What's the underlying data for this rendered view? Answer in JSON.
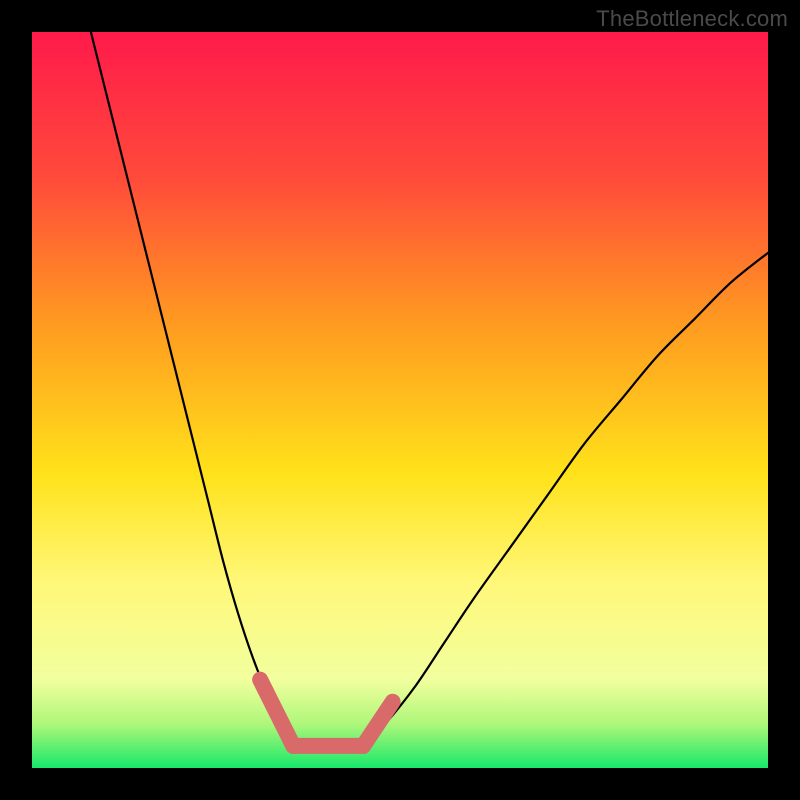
{
  "watermark": "TheBottleneck.com",
  "chart_data": {
    "type": "line",
    "title": "",
    "xlabel": "",
    "ylabel": "",
    "xlim": [
      0,
      100
    ],
    "ylim": [
      0,
      100
    ],
    "gradient_stops": [
      {
        "offset": 0,
        "color": "#ff1a4b"
      },
      {
        "offset": 20,
        "color": "#ff4b3a"
      },
      {
        "offset": 40,
        "color": "#ff9c20"
      },
      {
        "offset": 60,
        "color": "#ffe21a"
      },
      {
        "offset": 75,
        "color": "#fff87a"
      },
      {
        "offset": 88,
        "color": "#f2ff9e"
      },
      {
        "offset": 94,
        "color": "#aef77a"
      },
      {
        "offset": 100,
        "color": "#18e86a"
      }
    ],
    "series": [
      {
        "name": "left-curve",
        "x": [
          8,
          10,
          12,
          14,
          16,
          18,
          20,
          22,
          24,
          26,
          28,
          30,
          32,
          34,
          35.5
        ],
        "y": [
          100,
          92,
          84,
          76,
          68,
          60,
          52,
          44,
          36,
          28,
          21,
          15,
          10,
          6,
          3
        ]
      },
      {
        "name": "right-curve",
        "x": [
          45,
          48,
          52,
          56,
          60,
          65,
          70,
          75,
          80,
          85,
          90,
          95,
          100
        ],
        "y": [
          3,
          6,
          11,
          17,
          23,
          30,
          37,
          44,
          50,
          56,
          61,
          66,
          70
        ]
      }
    ],
    "annotations": [
      {
        "name": "pink-marker-left",
        "type": "band",
        "x": [
          31,
          35.5
        ],
        "y": [
          12,
          3
        ]
      },
      {
        "name": "pink-marker-flat",
        "type": "band",
        "x": [
          35.5,
          45
        ],
        "y": [
          3,
          3
        ]
      },
      {
        "name": "pink-marker-right",
        "type": "band",
        "x": [
          45,
          49
        ],
        "y": [
          3,
          9
        ]
      }
    ],
    "colors": {
      "curve": "#000000",
      "marker": "#d86a6a"
    }
  }
}
